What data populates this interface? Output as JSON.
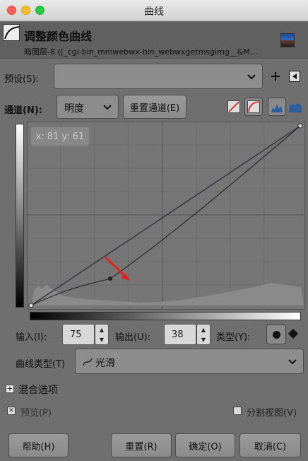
{
  "window": {
    "title": "曲线"
  },
  "header": {
    "title": "调整颜色曲线",
    "subtitle": "暗图层-8 ([_cgi-bin_mmwebwx-bin_webwxgetmsgimg__&M..."
  },
  "presets": {
    "label": "预设(S):",
    "value": ""
  },
  "channel": {
    "label": "通道(N):",
    "value": "明度",
    "reset_label": "重置通道(E)"
  },
  "graph": {
    "coord_readout": "x: 81 y: 61"
  },
  "io": {
    "input_label": "输入(I):",
    "input_value": "75",
    "output_label": "输出(U):",
    "output_value": "38",
    "type_label": "类型(Y):"
  },
  "curve_type": {
    "label": "曲线类型(T)",
    "value": "光滑"
  },
  "blend": {
    "label": "混合选项"
  },
  "preview": {
    "label": "预览(P)",
    "checked": true
  },
  "split": {
    "label": "分割视图(V)",
    "checked": false
  },
  "buttons": {
    "help": "帮助(H)",
    "reset": "重置(R)",
    "ok": "确定(O)",
    "cancel": "取消(C)"
  },
  "colors": {
    "arrow": "#e0231c",
    "dialog_bg": "#6f6f6f",
    "graph_bg": "#767676"
  }
}
